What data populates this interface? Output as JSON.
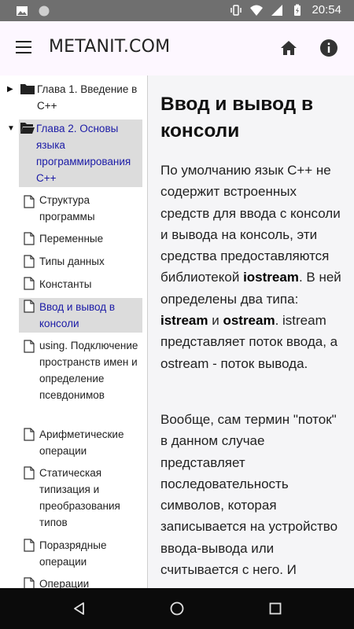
{
  "status_bar": {
    "time": "20:54",
    "icons": [
      "image-icon",
      "circle-icon",
      "vibrate-icon",
      "wifi-icon",
      "signal-icon",
      "battery-charging-icon"
    ]
  },
  "app_bar": {
    "title": "METANIT.COM",
    "icons": [
      "menu-icon",
      "home-icon",
      "info-icon"
    ]
  },
  "nav_tree": {
    "chapters": [
      {
        "label": "Глава 1. Введение в C++",
        "expanded": false
      },
      {
        "label": "Глава 2. Основы языка программирования C++",
        "expanded": true,
        "selected": true
      }
    ],
    "pages": [
      {
        "label": "Структура программы"
      },
      {
        "label": "Переменные"
      },
      {
        "label": "Типы данных"
      },
      {
        "label": "Константы"
      },
      {
        "label": "Ввод и вывод в консоли",
        "selected": true
      },
      {
        "label": "using. Подключение пространств имен и определение псевдонимов"
      },
      {
        "label": "Арифметические операции"
      },
      {
        "label": "Статическая типизация и преобразования типов"
      },
      {
        "label": "Поразрядные операции"
      },
      {
        "label": "Операции"
      }
    ]
  },
  "article": {
    "title": "Ввод и вывод в консоли",
    "p1": {
      "t1": "По умолчанию язык C++ не содержит встроенных средств для ввода с консоли и вывода на консоль, эти средства предоставляются библиотекой ",
      "b1": "iostream",
      "t2": ". В ней определены два типа: ",
      "b2": "istream",
      "t3": " и ",
      "b3": "ostream",
      "t4": ". istream представляет поток ввода, а ostream - поток вывода."
    },
    "p2": "Вообще, сам термин \"поток\" в данном случае представляет последовательность символов, которая записывается на устройство ввода-вывода или считывается с него. И"
  },
  "nav_bar": {
    "icons": [
      "back-icon",
      "home-circle-icon",
      "recents-icon"
    ]
  },
  "colors": {
    "status_bar": "#6f6f6f",
    "app_bar": "#fdf7ff",
    "content_bg": "#f5f5f7",
    "selection": "#dcdcdc",
    "active_link": "#1a1aa6",
    "nav_bar": "#0b0b0b"
  }
}
